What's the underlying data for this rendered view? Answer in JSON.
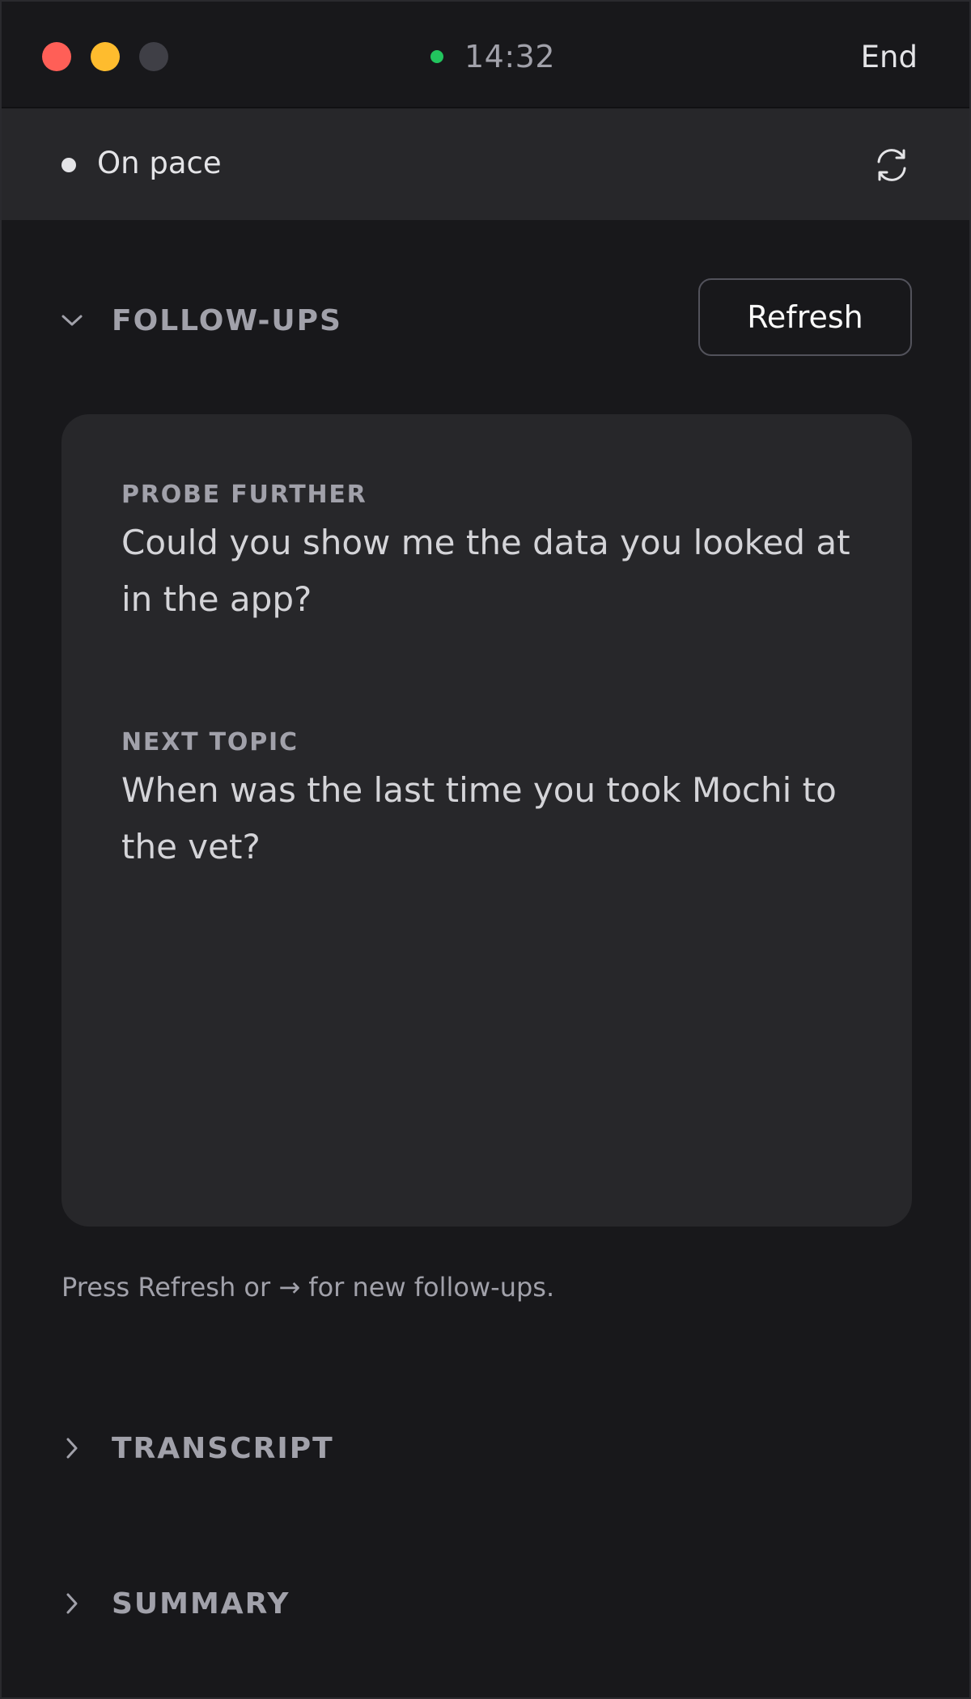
{
  "window": {
    "controls": [
      {
        "name": "close",
        "color": "#ff5f57"
      },
      {
        "name": "minimize",
        "color": "#febc2e"
      },
      {
        "name": "maximize",
        "color": "#3f3f46"
      }
    ]
  },
  "header": {
    "recording_color": "#22c55e",
    "timer": "14:32",
    "end_label": "End"
  },
  "status": {
    "pace_label": "On pace",
    "sync_icon": "refresh-cycle-icon"
  },
  "followups": {
    "title": "FOLLOW-UPS",
    "expanded": true,
    "refresh_label": "Refresh",
    "items": [
      {
        "label": "PROBE FURTHER",
        "text": "Could you show me the data you looked at in the app?"
      },
      {
        "label": "NEXT TOPIC",
        "text": "When was the last time you took Mochi to the vet?"
      }
    ],
    "hint": "Press Refresh or → for new follow-ups."
  },
  "sections": [
    {
      "title": "TRANSCRIPT",
      "expanded": false
    },
    {
      "title": "SUMMARY",
      "expanded": false
    }
  ]
}
